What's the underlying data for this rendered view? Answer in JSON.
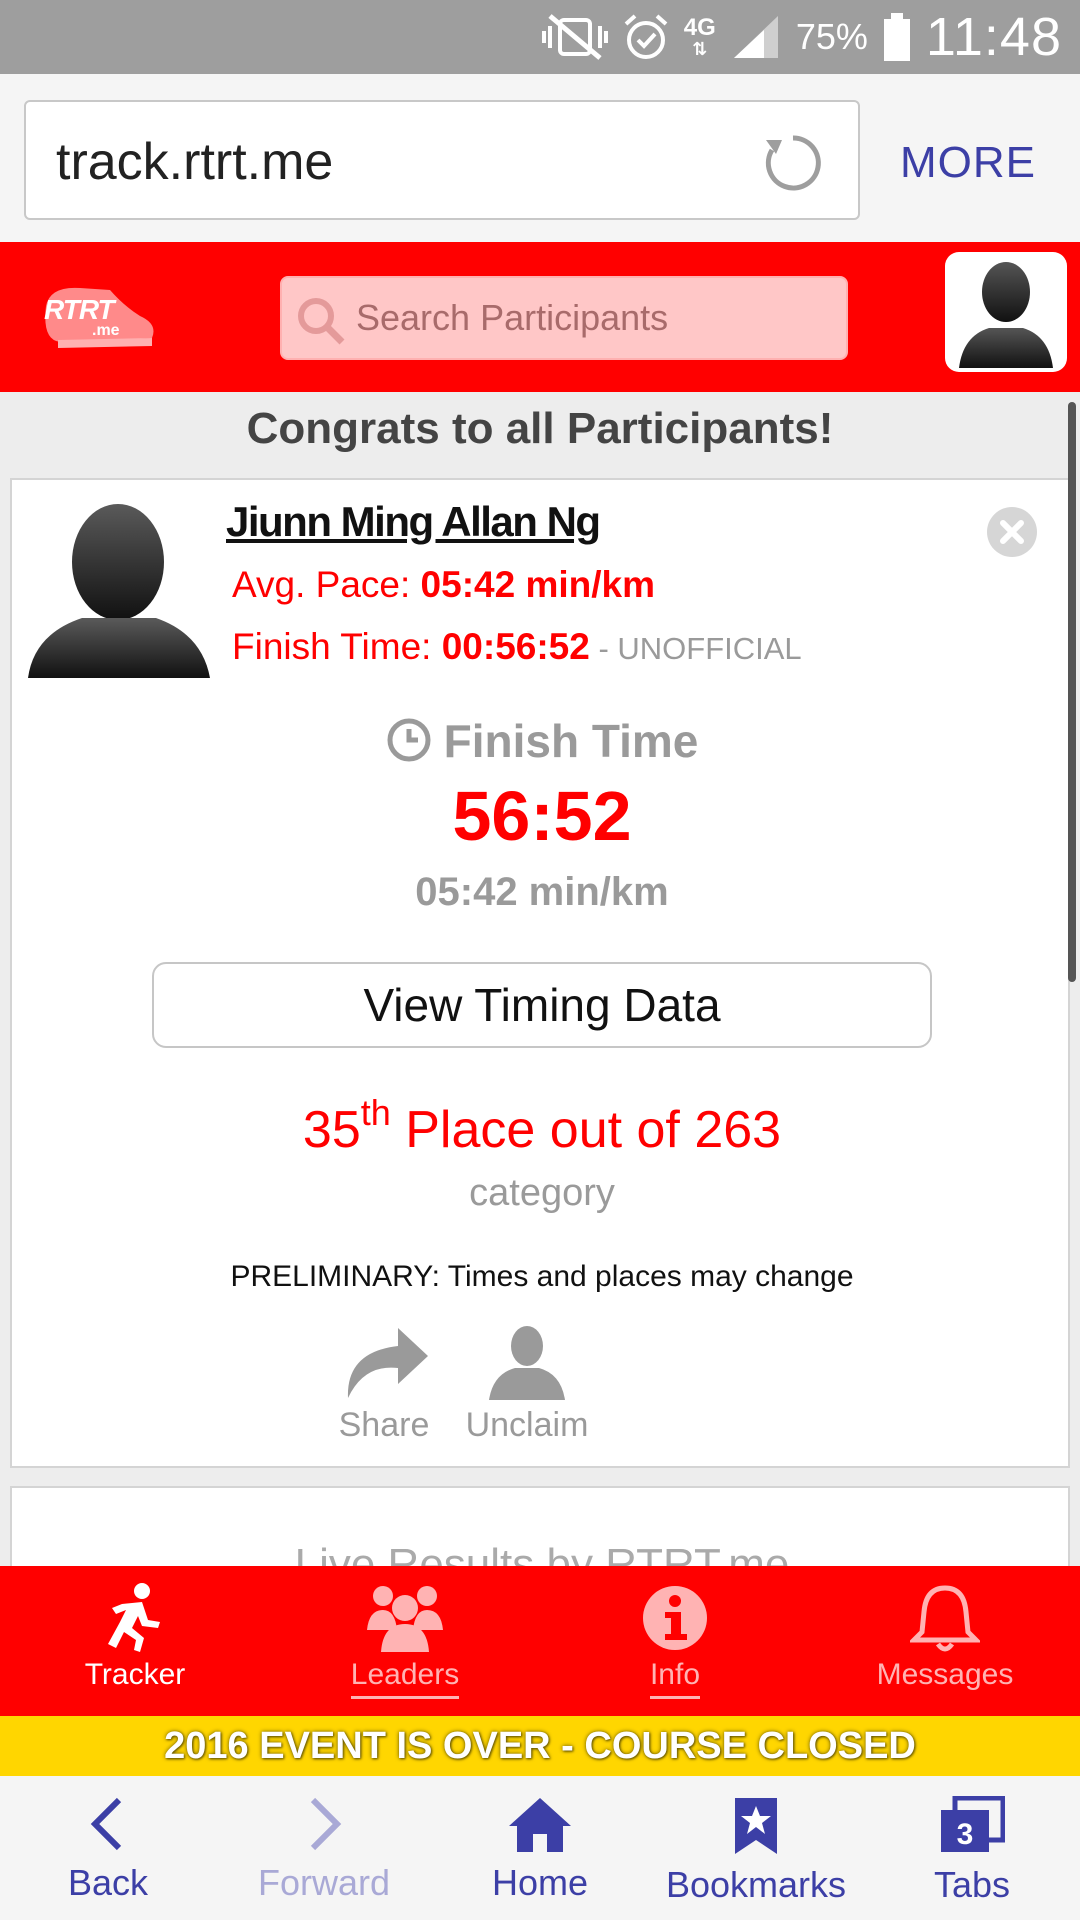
{
  "status_bar": {
    "network": "4G",
    "battery": "75%",
    "time": "11:48"
  },
  "browser": {
    "url": "track.rtrt.me",
    "more_label": "MORE"
  },
  "app_header": {
    "logo_text": "RTRT",
    "logo_subtext": ".me",
    "search_placeholder": "Search Participants"
  },
  "main": {
    "congrats": "Congrats to all Participants!",
    "participant": {
      "name": "Jiunn Ming Allan Ng",
      "pace_label": "Avg. Pace: ",
      "pace_value": "05:42 min/km",
      "finish_label": "Finish Time: ",
      "finish_value": "00:56:52",
      "finish_status": " - UNOFFICIAL"
    },
    "finish_heading": "Finish Time",
    "finish_big": "56:52",
    "finish_pace": "05:42 min/km",
    "view_timing_label": "View Timing Data",
    "place_number": "35",
    "place_suffix": "th",
    "place_rest": " Place out of 263",
    "place_category": "category",
    "preliminary": "PRELIMINARY: Times and places may change",
    "share_label": "Share",
    "unclaim_label": "Unclaim",
    "live_results": "Live Results by RTRT.me"
  },
  "app_nav": {
    "items": [
      {
        "label": "Tracker",
        "icon": "runner-icon"
      },
      {
        "label": "Leaders",
        "icon": "group-icon"
      },
      {
        "label": "Info",
        "icon": "info-icon"
      },
      {
        "label": "Messages",
        "icon": "bell-icon"
      }
    ]
  },
  "banner": "2016 EVENT IS OVER - COURSE CLOSED",
  "browser_toolbar": {
    "items": [
      {
        "label": "Back",
        "icon": "back-icon"
      },
      {
        "label": "Forward",
        "icon": "forward-icon"
      },
      {
        "label": "Home",
        "icon": "home-icon"
      },
      {
        "label": "Bookmarks",
        "icon": "bookmark-icon"
      },
      {
        "label": "Tabs",
        "icon": "tabs-icon"
      }
    ],
    "tabs_count": "3"
  },
  "colors": {
    "brand_red": "#ff0000",
    "browser_accent": "#3c3fa6",
    "banner_yellow": "#ffd600",
    "muted_gray": "#9a9a9a"
  }
}
